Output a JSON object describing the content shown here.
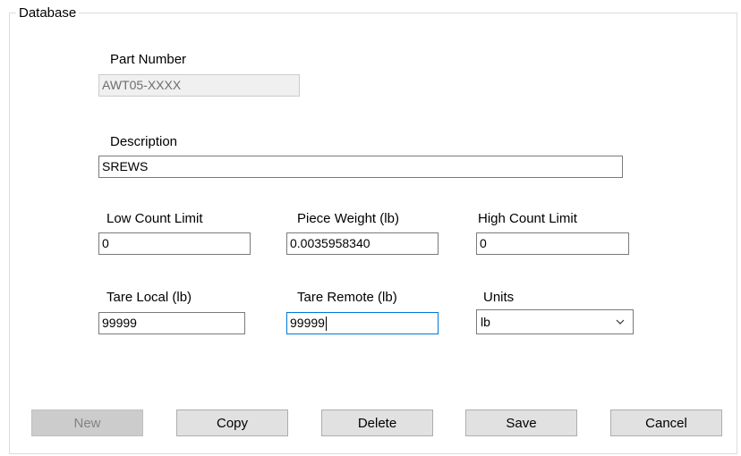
{
  "group": {
    "title": "Database"
  },
  "part_number": {
    "label": "Part Number",
    "value": "AWT05-XXXX"
  },
  "description": {
    "label": "Description",
    "value": "SREWS"
  },
  "low_count": {
    "label": "Low Count Limit",
    "value": "0"
  },
  "piece_weight": {
    "label": "Piece Weight (lb)",
    "value": "0.0035958340"
  },
  "high_count": {
    "label": "High Count Limit",
    "value": "0"
  },
  "tare_local": {
    "label": "Tare Local (lb)",
    "value": "99999"
  },
  "tare_remote": {
    "label": "Tare Remote (lb)",
    "value": "99999"
  },
  "units": {
    "label": "Units",
    "value": "lb"
  },
  "buttons": {
    "new": "New",
    "copy": "Copy",
    "delete": "Delete",
    "save": "Save",
    "cancel": "Cancel"
  },
  "icons": {
    "units_dropdown": "chevron-down-icon"
  }
}
